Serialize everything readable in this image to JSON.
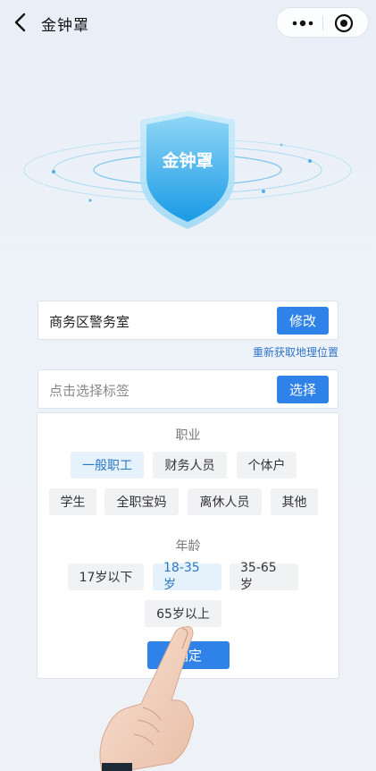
{
  "header": {
    "title": "金钟罩",
    "back_icon": "chevron-left-icon",
    "more_icon": "more-dots-icon",
    "close_icon": "target-close-icon"
  },
  "hero": {
    "badge_text": "金钟罩",
    "icon": "shield-icon"
  },
  "location": {
    "value": "商务区警务室",
    "button_label": "修改",
    "relocate_link": "重新获取地理位置"
  },
  "tag_select": {
    "placeholder": "点击选择标签",
    "button_label": "选择"
  },
  "panel": {
    "occupation_title": "职业",
    "occupations": [
      "一般职工",
      "财务人员",
      "个体户",
      "学生",
      "全职宝妈",
      "离休人员",
      "其他"
    ],
    "occupation_selected": "一般职工",
    "age_title": "年龄",
    "ages": [
      "17岁以下",
      "18-35岁",
      "35-65岁",
      "65岁以上"
    ],
    "age_selected": "18-35岁",
    "confirm_label": "确定"
  },
  "colors": {
    "primary": "#2f82e8",
    "link": "#2f74c9",
    "chip_selected_bg": "#e5f1fb",
    "chip_selected_text": "#2a78c4",
    "background": "#e9eff7"
  }
}
